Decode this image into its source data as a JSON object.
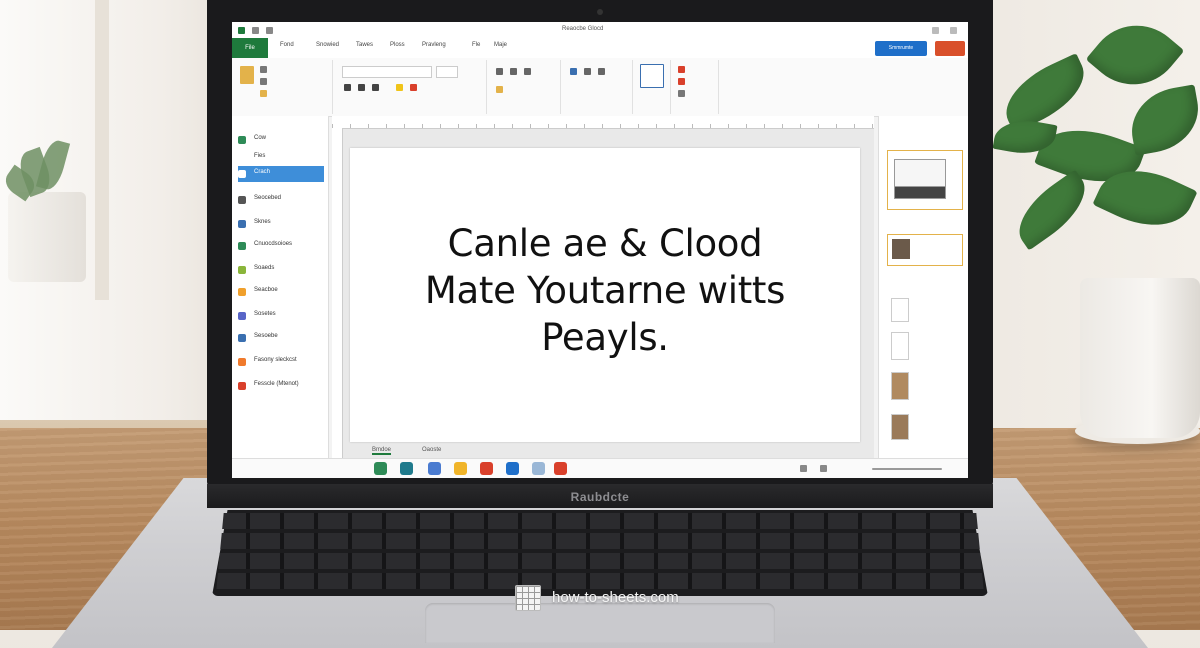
{
  "screen": {
    "title": "Reaocbe Glocd",
    "tabs": [
      "Fond",
      "Snowied",
      "Tawes",
      "Ploss",
      "Pravleng",
      "Fle",
      "Maje"
    ],
    "share_label": "Smmrumte",
    "sidebar_items": [
      {
        "label": "Cow",
        "color": "#2e8b57"
      },
      {
        "label": "Fies",
        "color": "#ffffff"
      },
      {
        "label": "Crach",
        "color": "#ffffff",
        "selected": true
      },
      {
        "label": "Seocebed",
        "color": "#555555"
      },
      {
        "label": "Sknes",
        "color": "#3a6fb0"
      },
      {
        "label": "Cnuocdsoioes",
        "color": "#2e8b57"
      },
      {
        "label": "Soaeds",
        "color": "#8ab53a"
      },
      {
        "label": "Seacboe",
        "color": "#f0a02c"
      },
      {
        "label": "Sosetes",
        "color": "#5865c7"
      },
      {
        "label": "Sesoebe",
        "color": "#3a6fb0"
      },
      {
        "label": "Fasony sleckcst",
        "color": "#f07a2c"
      },
      {
        "label": "Fesscle (Mtenot)",
        "color": "#d9402b"
      }
    ],
    "headline_lines": [
      "Canle ae & Clood",
      "Mate Youtarne witts",
      "Peayls."
    ],
    "sheet_tabs": [
      "Bmdoe",
      "Oaoste"
    ],
    "taskbar_colors": [
      "#2e8b57",
      "#1f7a8c",
      "#4a7bd0",
      "#f0b429",
      "#d9402b",
      "#1f6fc9",
      "#9ab7d6",
      "#d9402b"
    ]
  },
  "laptop_brand": "Raubdcte",
  "watermark": "how-to-sheets.com"
}
